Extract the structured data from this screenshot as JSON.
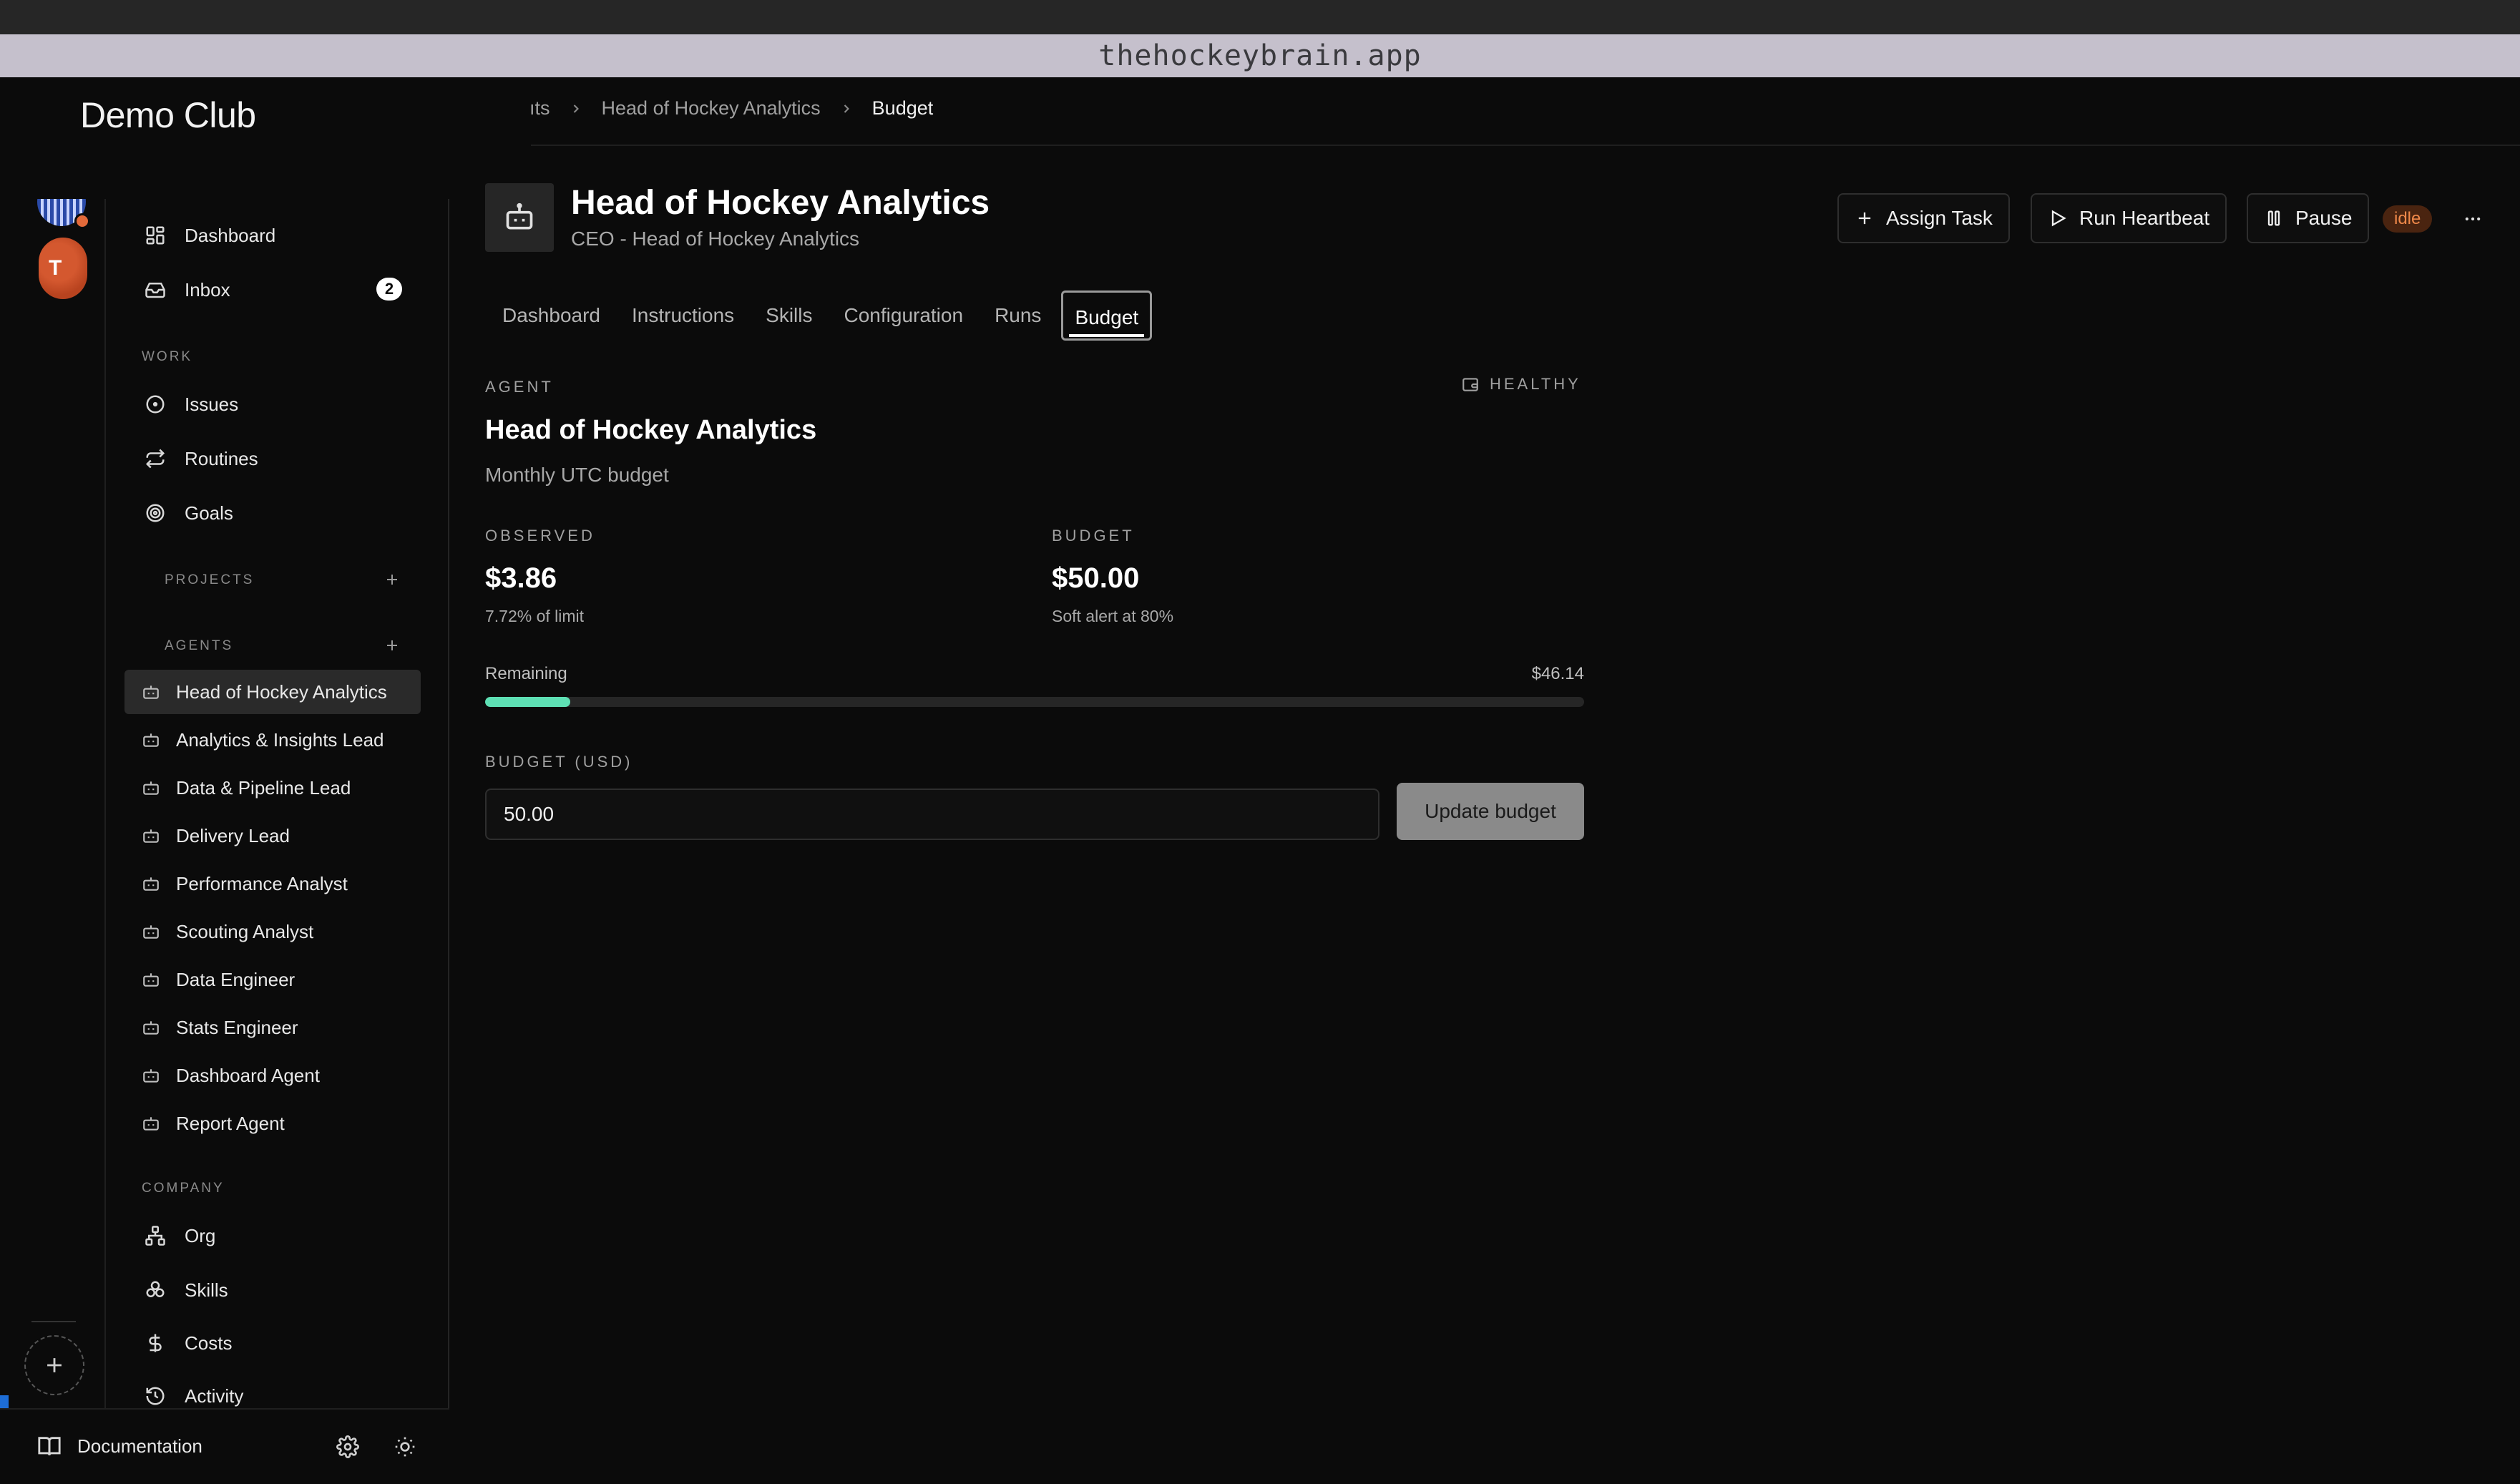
{
  "browser": {
    "url": "thehockeybrain.app"
  },
  "club": {
    "name": "Demo Club",
    "avatar_letter": "T"
  },
  "breadcrumb": {
    "items": [
      "ıts",
      "Head of Hockey Analytics",
      "Budget"
    ]
  },
  "nav": {
    "dashboard": "Dashboard",
    "inbox": "Inbox",
    "inbox_count": "2",
    "work_section": "WORK",
    "issues": "Issues",
    "routines": "Routines",
    "goals": "Goals",
    "projects_section": "PROJECTS",
    "agents_section": "AGENTS",
    "company_section": "COMPANY",
    "org": "Org",
    "skills": "Skills",
    "costs": "Costs",
    "activity": "Activity",
    "documentation": "Documentation"
  },
  "agents": [
    "Head of Hockey Analytics",
    "Analytics & Insights Lead",
    "Data & Pipeline Lead",
    "Delivery Lead",
    "Performance Analyst",
    "Scouting Analyst",
    "Data Engineer",
    "Stats Engineer",
    "Dashboard Agent",
    "Report Agent"
  ],
  "header": {
    "title": "Head of Hockey Analytics",
    "subtitle": "CEO - Head of Hockey Analytics",
    "assign_task": "Assign Task",
    "run_heartbeat": "Run Heartbeat",
    "pause": "Pause",
    "status": "idle"
  },
  "tabs": [
    "Dashboard",
    "Instructions",
    "Skills",
    "Configuration",
    "Runs",
    "Budget"
  ],
  "active_tab": "Budget",
  "budget": {
    "agent_label": "AGENT",
    "health": "HEALTHY",
    "agent_name": "Head of Hockey Analytics",
    "period": "Monthly UTC budget",
    "observed_label": "OBSERVED",
    "observed_value": "$3.86",
    "observed_note": "7.72% of limit",
    "budget_label": "BUDGET",
    "budget_value": "$50.00",
    "budget_note": "Soft alert at 80%",
    "remaining_label": "Remaining",
    "remaining_value": "$46.14",
    "used_fraction": 0.0772,
    "input_label": "BUDGET (USD)",
    "input_value": "50.00",
    "update_button": "Update budget"
  },
  "colors": {
    "progress_fill": "#5ee0b4",
    "idle_badge_bg": "#4a2410",
    "idle_badge_text": "#f0894a"
  }
}
